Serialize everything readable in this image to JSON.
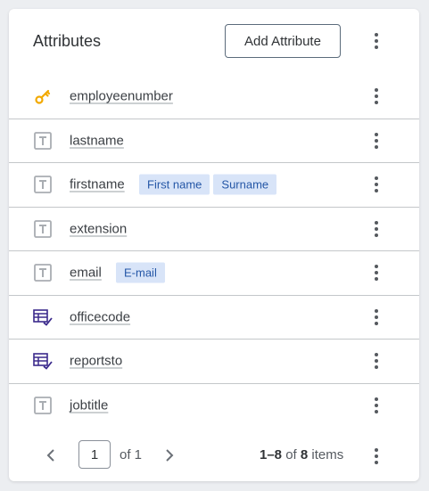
{
  "header": {
    "title": "Attributes",
    "add_button_label": "Add Attribute"
  },
  "rows": [
    {
      "name": "employeenumber",
      "icon": "key-icon",
      "tags": []
    },
    {
      "name": "lastname",
      "icon": "text-type-icon",
      "tags": []
    },
    {
      "name": "firstname",
      "icon": "text-type-icon",
      "tags": [
        "First name",
        "Surname"
      ]
    },
    {
      "name": "extension",
      "icon": "text-type-icon",
      "tags": []
    },
    {
      "name": "email",
      "icon": "text-type-icon",
      "tags": [
        "E-mail"
      ]
    },
    {
      "name": "officecode",
      "icon": "reference-table-icon",
      "tags": []
    },
    {
      "name": "reportsto",
      "icon": "reference-table-icon",
      "tags": []
    },
    {
      "name": "jobtitle",
      "icon": "text-type-icon",
      "tags": []
    }
  ],
  "pagination": {
    "current_page": "1",
    "of_label": "of 1",
    "range_start_end": "1–8",
    "range_of": "of",
    "total": "8",
    "items_label": "items"
  },
  "colors": {
    "key_icon": "#f2a900",
    "text_icon": "#a9adb2",
    "table_icon": "#3b2a8c",
    "tag_bg": "#d8e4f8",
    "tag_text": "#2557a7"
  }
}
